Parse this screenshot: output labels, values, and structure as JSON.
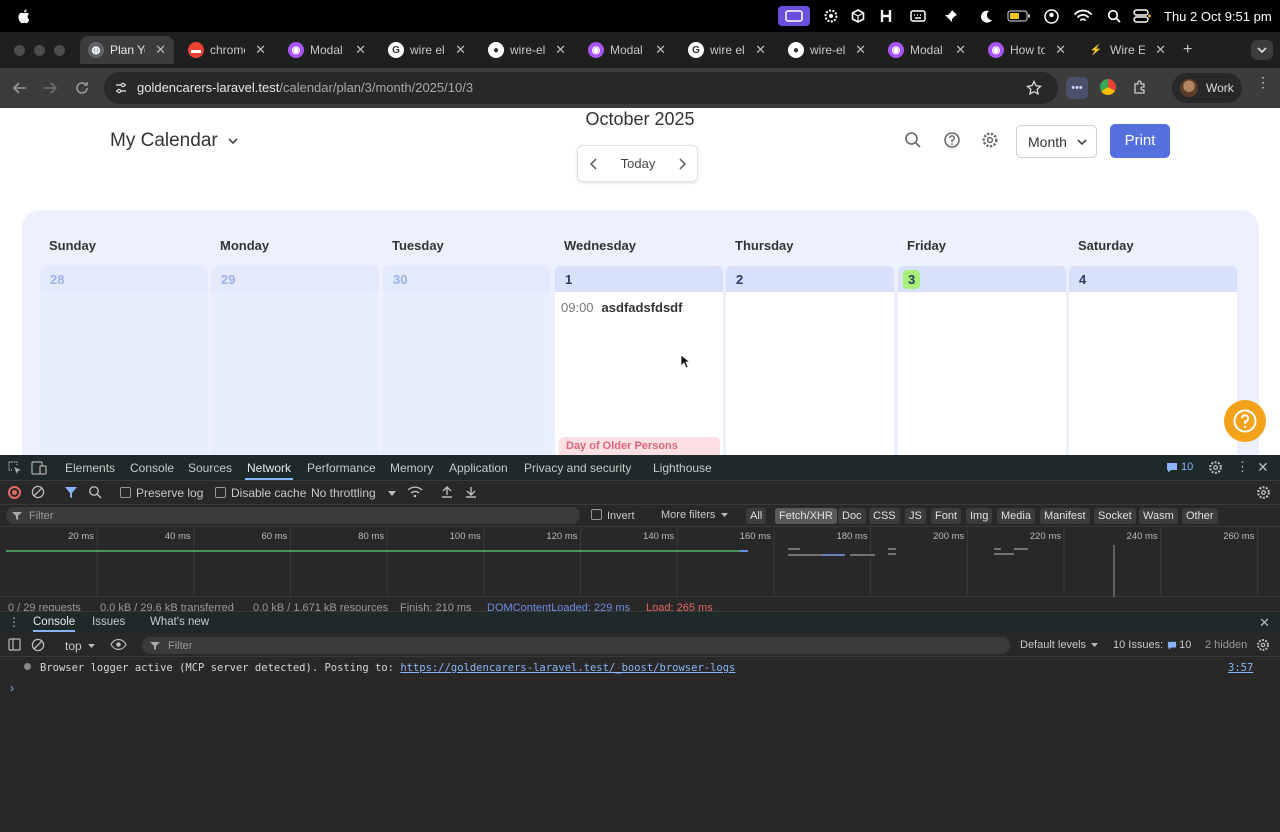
{
  "menubar": {
    "clock": "Thu 2 Oct  9:51 pm"
  },
  "tabs": [
    {
      "title": "Plan Yo",
      "icon": "globe-icon",
      "active": true
    },
    {
      "title": "chrome",
      "icon": "video-icon"
    },
    {
      "title": "Modal",
      "icon": "livewire-icon"
    },
    {
      "title": "wire ele",
      "icon": "google-icon"
    },
    {
      "title": "wire-el",
      "icon": "github-icon"
    },
    {
      "title": "Modal",
      "icon": "livewire-icon"
    },
    {
      "title": "wire ele",
      "icon": "google-icon"
    },
    {
      "title": "wire-el",
      "icon": "github-icon"
    },
    {
      "title": "Modal",
      "icon": "livewire-icon"
    },
    {
      "title": "How to",
      "icon": "livewire-icon"
    },
    {
      "title": "Wire El",
      "icon": "laravel-icon"
    }
  ],
  "address": {
    "host": "goldencarers-laravel.test",
    "path": "/calendar/plan/3/month/2025/10/3"
  },
  "profile": {
    "label": "Work"
  },
  "calendar": {
    "title": "My Calendar",
    "month_label": "October 2025",
    "today_label": "Today",
    "view_select": "Month",
    "print_label": "Print",
    "days": [
      "Sunday",
      "Monday",
      "Tuesday",
      "Wednesday",
      "Thursday",
      "Friday",
      "Saturday"
    ],
    "dates": [
      "28",
      "29",
      "30",
      "1",
      "2",
      "3",
      "4"
    ],
    "event": {
      "time": "09:00",
      "title": "asdfadsfdsdf"
    },
    "holiday": "Day of Older Persons"
  },
  "devtools": {
    "tabs": [
      "Elements",
      "Console",
      "Sources",
      "Network",
      "Performance",
      "Memory",
      "Application",
      "Privacy and security",
      "Lighthouse"
    ],
    "active_tab": "Network",
    "issues_count": "10",
    "preserve_log": "Preserve log",
    "disable_cache": "Disable cache",
    "throttling": "No throttling",
    "filter_placeholder": "Filter",
    "invert": "Invert",
    "more_filters": "More filters",
    "type_filters": [
      "All",
      "Fetch/XHR",
      "Doc",
      "CSS",
      "JS",
      "Font",
      "Img",
      "Media",
      "Manifest",
      "Socket",
      "Wasm",
      "Other"
    ],
    "type_filter_selected": "Fetch/XHR",
    "timeline_ticks": [
      "20 ms",
      "40 ms",
      "60 ms",
      "80 ms",
      "100 ms",
      "120 ms",
      "140 ms",
      "160 ms",
      "180 ms",
      "200 ms",
      "220 ms",
      "240 ms",
      "260 ms"
    ],
    "summary": [
      "0 / 29 requests",
      "0.0 kB / 29.6 kB transferred",
      "0.0 kB / 1,671 kB resources",
      "Finish: 210 ms",
      "DOMContentLoaded: 229 ms",
      "Load: 265 ms"
    ],
    "drawer_tabs": [
      "Console",
      "Issues",
      "What's new"
    ],
    "context": "top",
    "console_filter": "Filter",
    "levels": "Default levels",
    "issues_label": "10 Issues:",
    "issues_badge": "10",
    "hidden": "2 hidden",
    "log": {
      "text": "Browser logger active (MCP server detected). Posting to: ",
      "link": "https://goldencarers-laravel.test/_boost/browser-logs",
      "source": "3:57"
    }
  },
  "colors": {
    "accent": "#5470de",
    "today_badge": "#a8f07a",
    "holiday_bg": "#fde0e4",
    "holiday_text": "#d8677a",
    "help_fab": "#f2a31a"
  }
}
